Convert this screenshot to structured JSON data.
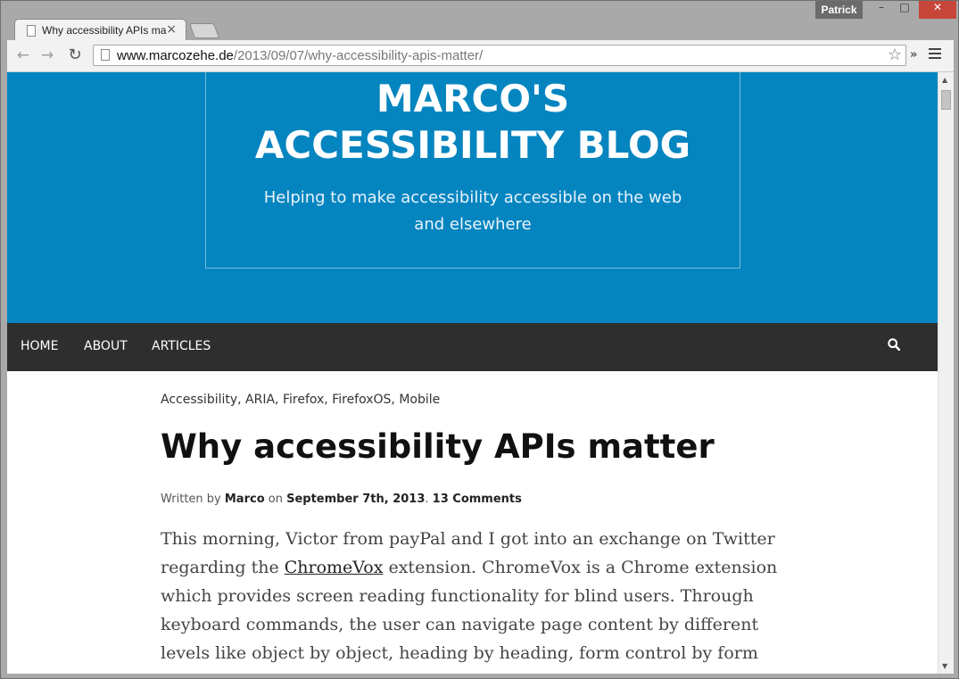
{
  "browser": {
    "tab_title": "Why accessibility APIs ma",
    "tab_close": "×",
    "profile_name": "Patrick",
    "win_min": "–",
    "win_max": "□",
    "win_close": "✕",
    "url_host": "www.marcozehe.de",
    "url_path": "/2013/09/07/why-accessibility-apis-matter/",
    "back": "←",
    "forward": "→",
    "reload": "↻",
    "star": "☆",
    "more": "»"
  },
  "site": {
    "title": "MARCO'S ACCESSIBILITY BLOG",
    "tagline": "Helping to make accessibility accessible on the web and elsewhere",
    "accent_color": "#0585c0",
    "nav": {
      "home": "HOME",
      "about": "ABOUT",
      "articles": "ARTICLES"
    }
  },
  "article": {
    "categories": "Accessibility, ARIA, Firefox, FirefoxOS, Mobile",
    "title": "Why accessibility APIs matter",
    "byline": {
      "written_by": "Written by ",
      "author": "Marco",
      "on": " on ",
      "date": "September 7th, 2013",
      "sep": ". ",
      "comments": "13 Comments"
    },
    "body": {
      "before_link": "This morning, Victor from payPal and I got into an exchange on Twitter regarding the ",
      "link_text": "ChromeVox",
      "after_link": " extension. ChromeVox is a Chrome extension which provides screen reading functionality for blind users. Through keyboard commands, the user can navigate page content by different levels like object by object, heading by heading, form control by form control, etc."
    }
  },
  "scrollbar": {
    "up": "▲",
    "down": "▼"
  }
}
